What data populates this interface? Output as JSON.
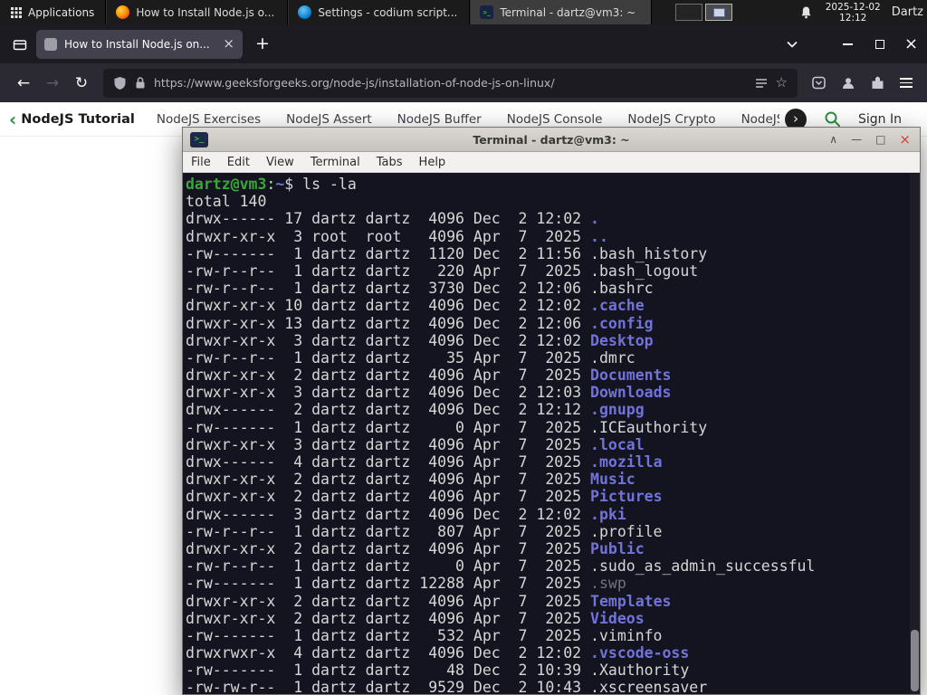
{
  "taskbar": {
    "applications_label": "Applications",
    "windows": [
      {
        "app": "firefox",
        "title": "How to Install Node.js o...",
        "active": false
      },
      {
        "app": "codium",
        "title": "Settings - codium script...",
        "active": false
      },
      {
        "app": "terminal",
        "title": "Terminal - dartz@vm3: ~",
        "active": true
      }
    ],
    "clock_date": "2025-12-02",
    "clock_time": "12:12",
    "user": "Dartz"
  },
  "browser": {
    "tab_title": "How to Install Node.js on...",
    "url": "https://www.geeksforgeeks.org/node-js/installation-of-node-js-on-linux/"
  },
  "page_nav": {
    "active": "NodeJS Tutorial",
    "links": [
      "NodeJS Exercises",
      "NodeJS Assert",
      "NodeJS Buffer",
      "NodeJS Console",
      "NodeJS Crypto",
      "NodeJS DNS",
      "Node"
    ],
    "sign_in": "Sign In"
  },
  "terminal": {
    "title": "Terminal - dartz@vm3: ~",
    "menu": [
      "File",
      "Edit",
      "View",
      "Terminal",
      "Tabs",
      "Help"
    ],
    "colors": {
      "background": "#141420",
      "prompt_green": "#36a936",
      "directory_blue": "#7173da",
      "dim_gray": "#73737c"
    },
    "lines": [
      [
        [
          "dartz@vm3",
          "g"
        ],
        [
          ":",
          ""
        ],
        [
          "~",
          "b"
        ],
        [
          "$ ls -la",
          ""
        ]
      ],
      "total 140",
      [
        [
          "drwx------ 17 dartz dartz  4096 Dec  2 12:02 ",
          ""
        ],
        [
          ".",
          "b"
        ]
      ],
      [
        [
          "drwxr-xr-x  3 root  root   4096 Apr  7  2025 ",
          ""
        ],
        [
          "..",
          "b"
        ]
      ],
      "-rw-------  1 dartz dartz  1120 Dec  2 11:56 .bash_history",
      "-rw-r--r--  1 dartz dartz   220 Apr  7  2025 .bash_logout",
      "-rw-r--r--  1 dartz dartz  3730 Dec  2 12:06 .bashrc",
      [
        [
          "drwxr-xr-x 10 dartz dartz  4096 Dec  2 12:02 ",
          ""
        ],
        [
          ".cache",
          "b"
        ]
      ],
      [
        [
          "drwxr-xr-x 13 dartz dartz  4096 Dec  2 12:06 ",
          ""
        ],
        [
          ".config",
          "b"
        ]
      ],
      [
        [
          "drwxr-xr-x  3 dartz dartz  4096 Dec  2 12:02 ",
          ""
        ],
        [
          "Desktop",
          "b"
        ]
      ],
      "-rw-r--r--  1 dartz dartz    35 Apr  7  2025 .dmrc",
      [
        [
          "drwxr-xr-x  2 dartz dartz  4096 Apr  7  2025 ",
          ""
        ],
        [
          "Documents",
          "b"
        ]
      ],
      [
        [
          "drwxr-xr-x  3 dartz dartz  4096 Dec  2 12:03 ",
          ""
        ],
        [
          "Downloads",
          "b"
        ]
      ],
      [
        [
          "drwx------  2 dartz dartz  4096 Dec  2 12:12 ",
          ""
        ],
        [
          ".gnupg",
          "b"
        ]
      ],
      "-rw-------  1 dartz dartz     0 Apr  7  2025 .ICEauthority",
      [
        [
          "drwxr-xr-x  3 dartz dartz  4096 Apr  7  2025 ",
          ""
        ],
        [
          ".local",
          "b"
        ]
      ],
      [
        [
          "drwx------  4 dartz dartz  4096 Apr  7  2025 ",
          ""
        ],
        [
          ".mozilla",
          "b"
        ]
      ],
      [
        [
          "drwxr-xr-x  2 dartz dartz  4096 Apr  7  2025 ",
          ""
        ],
        [
          "Music",
          "b"
        ]
      ],
      [
        [
          "drwxr-xr-x  2 dartz dartz  4096 Apr  7  2025 ",
          ""
        ],
        [
          "Pictures",
          "b"
        ]
      ],
      [
        [
          "drwx------  3 dartz dartz  4096 Dec  2 12:02 ",
          ""
        ],
        [
          ".pki",
          "b"
        ]
      ],
      "-rw-r--r--  1 dartz dartz   807 Apr  7  2025 .profile",
      [
        [
          "drwxr-xr-x  2 dartz dartz  4096 Apr  7  2025 ",
          ""
        ],
        [
          "Public",
          "b"
        ]
      ],
      "-rw-r--r--  1 dartz dartz     0 Apr  7  2025 .sudo_as_admin_successful",
      [
        [
          "-rw-------  1 dartz dartz 12288 Apr  7  2025 ",
          ""
        ],
        [
          ".swp",
          "d"
        ]
      ],
      [
        [
          "drwxr-xr-x  2 dartz dartz  4096 Apr  7  2025 ",
          ""
        ],
        [
          "Templates",
          "b"
        ]
      ],
      [
        [
          "drwxr-xr-x  2 dartz dartz  4096 Apr  7  2025 ",
          ""
        ],
        [
          "Videos",
          "b"
        ]
      ],
      "-rw-------  1 dartz dartz   532 Apr  7  2025 .viminfo",
      [
        [
          "drwxrwxr-x  4 dartz dartz  4096 Dec  2 12:02 ",
          ""
        ],
        [
          ".vscode-oss",
          "b"
        ]
      ],
      "-rw-------  1 dartz dartz    48 Dec  2 10:39 .Xauthority",
      "-rw-rw-r--  1 dartz dartz  9529 Dec  2 10:43 .xscreensaver"
    ]
  }
}
